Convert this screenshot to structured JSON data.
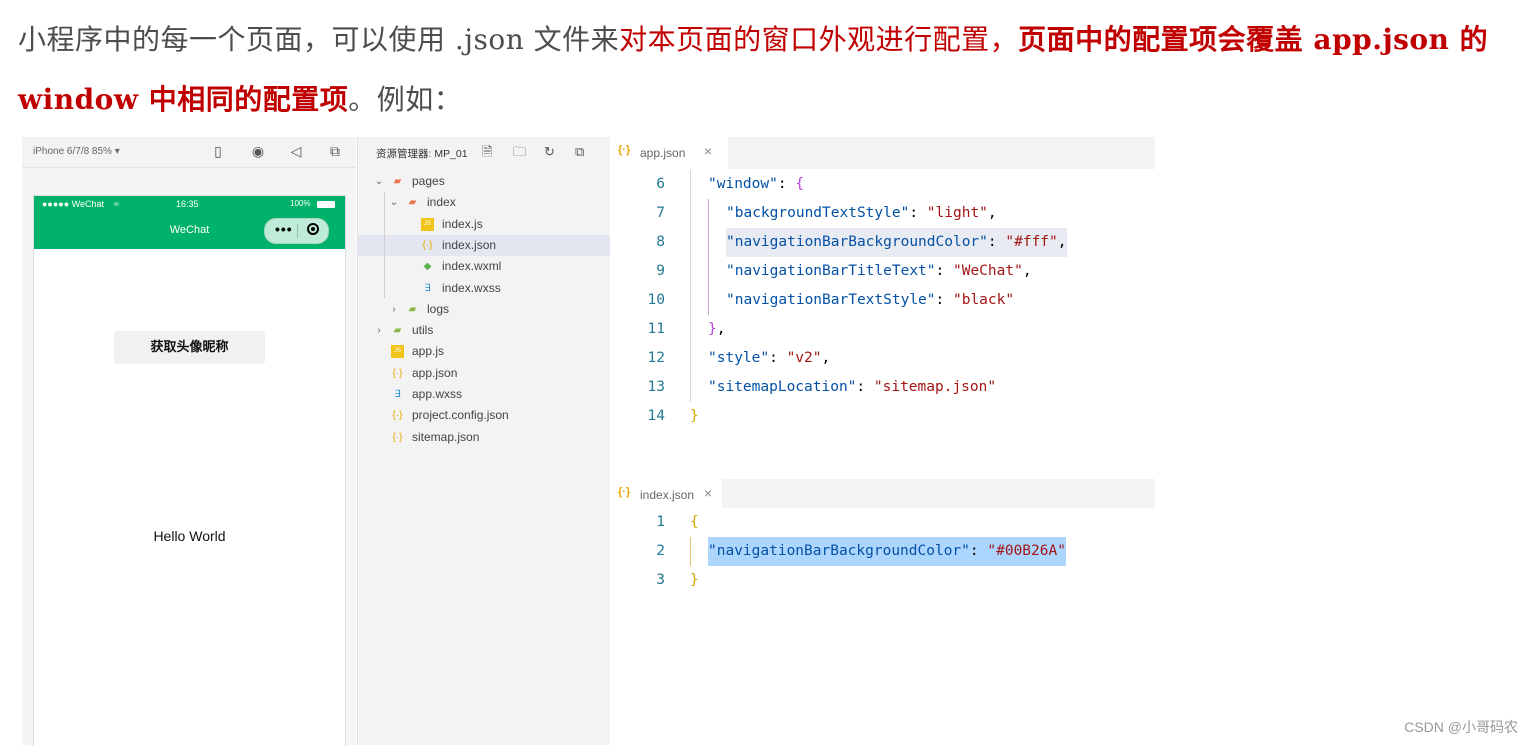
{
  "intro": {
    "part1": "小程序中的每一个页面，可以使用 .json 文件来",
    "part2_red": "对本页面的窗口外观进行配置，",
    "part3_red_bold": "页面中的配置项会覆盖 app.json 的 window 中相同的配置项",
    "part4": "。例如："
  },
  "simulator": {
    "device": "iPhone 6/7/8 85% ▾",
    "status": {
      "signal": "●●●●● WeChat",
      "time": "16:35",
      "battery": "100%"
    },
    "nav_title": "WeChat",
    "avatar_button": "获取头像昵称",
    "hello": "Hello World",
    "colors": {
      "navbar": "#00B26A"
    }
  },
  "explorer": {
    "title": "资源管理器: MP_01",
    "tree": [
      {
        "name": "pages",
        "type": "folder-open",
        "depth": 0
      },
      {
        "name": "index",
        "type": "folder-open",
        "depth": 1
      },
      {
        "name": "index.js",
        "type": "js",
        "depth": 2
      },
      {
        "name": "index.json",
        "type": "json",
        "depth": 2,
        "selected": true
      },
      {
        "name": "index.wxml",
        "type": "wxml",
        "depth": 2
      },
      {
        "name": "index.wxss",
        "type": "wxss",
        "depth": 2
      },
      {
        "name": "logs",
        "type": "folder",
        "depth": 1
      },
      {
        "name": "utils",
        "type": "folder",
        "depth": 0
      },
      {
        "name": "app.js",
        "type": "js",
        "depth": 0
      },
      {
        "name": "app.json",
        "type": "json",
        "depth": 0
      },
      {
        "name": "app.wxss",
        "type": "wxss",
        "depth": 0
      },
      {
        "name": "project.config.json",
        "type": "json",
        "depth": 0
      },
      {
        "name": "sitemap.json",
        "type": "json",
        "depth": 0
      }
    ]
  },
  "editor1": {
    "tab_label": "app.json",
    "lines": [
      {
        "n": "6",
        "tokens": [
          [
            "k",
            "\"window\""
          ],
          [
            "p",
            ": "
          ],
          [
            "b2",
            "{"
          ]
        ]
      },
      {
        "n": "7",
        "tokens": [
          [
            "k",
            "\"backgroundTextStyle\""
          ],
          [
            "p",
            ": "
          ],
          [
            "s",
            "\"light\""
          ],
          [
            "p",
            ","
          ]
        ]
      },
      {
        "n": "8",
        "tokens": [
          [
            "k",
            "\"navigationBarBackgroundColor\""
          ],
          [
            "p",
            ": "
          ],
          [
            "s",
            "\"#fff\""
          ],
          [
            "p",
            ","
          ]
        ],
        "highlight": "grey"
      },
      {
        "n": "9",
        "tokens": [
          [
            "k",
            "\"navigationBarTitleText\""
          ],
          [
            "p",
            ": "
          ],
          [
            "s",
            "\"WeChat\""
          ],
          [
            "p",
            ","
          ]
        ]
      },
      {
        "n": "10",
        "tokens": [
          [
            "k",
            "\"navigationBarTextStyle\""
          ],
          [
            "p",
            ": "
          ],
          [
            "s",
            "\"black\""
          ]
        ]
      },
      {
        "n": "11",
        "tokens": [
          [
            "b2",
            "}"
          ],
          [
            "p",
            ","
          ]
        ]
      },
      {
        "n": "12",
        "tokens": [
          [
            "k",
            "\"style\""
          ],
          [
            "p",
            ": "
          ],
          [
            "s",
            "\"v2\""
          ],
          [
            "p",
            ","
          ]
        ]
      },
      {
        "n": "13",
        "tokens": [
          [
            "k",
            "\"sitemapLocation\""
          ],
          [
            "p",
            ": "
          ],
          [
            "s",
            "\"sitemap.json\""
          ]
        ]
      },
      {
        "n": "14",
        "tokens": [
          [
            "b1",
            "}"
          ]
        ]
      }
    ]
  },
  "editor2": {
    "tab_label": "index.json",
    "lines": [
      {
        "n": "1",
        "tokens": [
          [
            "b1",
            "{"
          ]
        ]
      },
      {
        "n": "2",
        "tokens": [
          [
            "k",
            "\"navigationBarBackgroundColor\""
          ],
          [
            "p",
            ": "
          ],
          [
            "s",
            "\"#00B26A\""
          ]
        ],
        "highlight": "blue"
      },
      {
        "n": "3",
        "tokens": [
          [
            "b1",
            "}"
          ]
        ]
      }
    ]
  },
  "watermark": "CSDN @小哥码农"
}
